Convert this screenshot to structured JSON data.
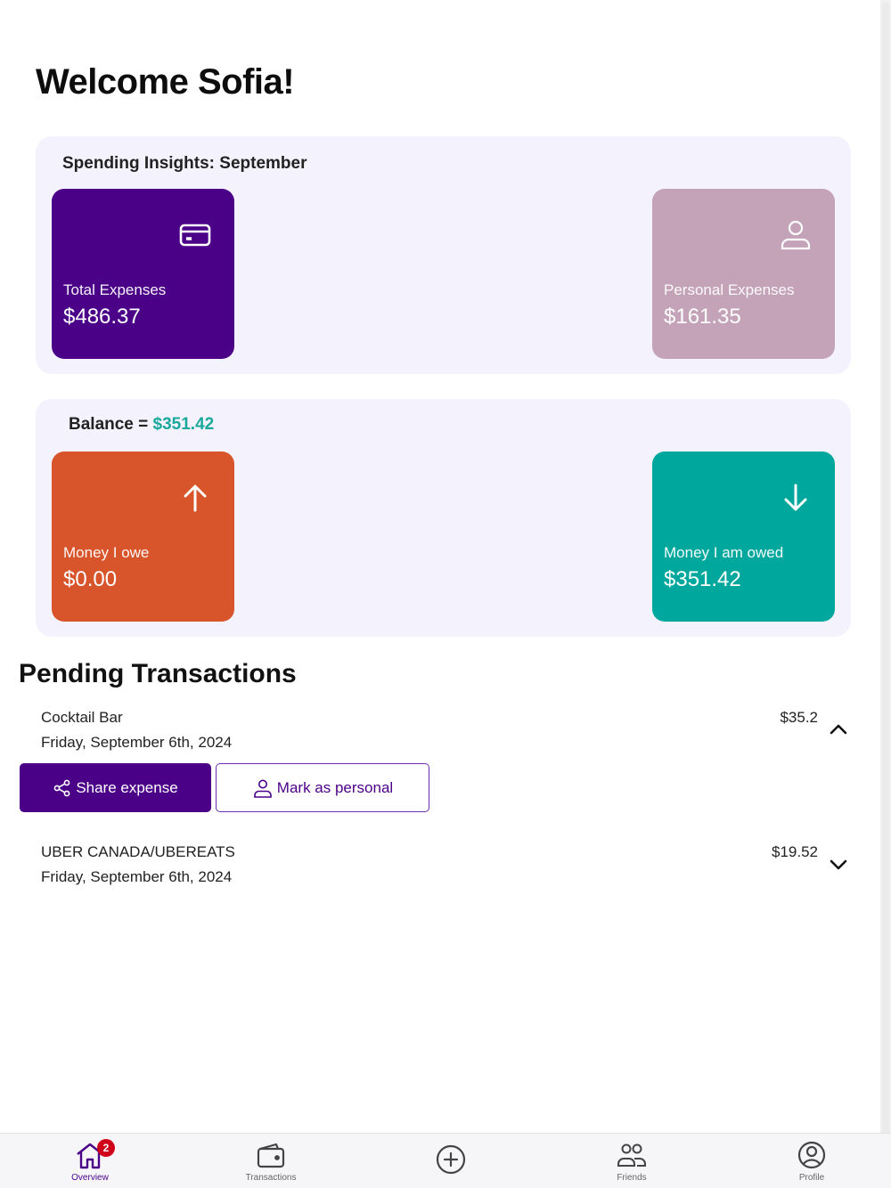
{
  "welcome": "Welcome Sofia!",
  "insights": {
    "title": "Spending Insights: September",
    "total": {
      "label": "Total Expenses",
      "value": "$486.37",
      "icon": "credit-card-icon"
    },
    "personal": {
      "label": "Personal Expenses",
      "value": "$161.35",
      "icon": "user-icon"
    }
  },
  "balance": {
    "label": "Balance = ",
    "amount": "$351.42",
    "owe": {
      "label": "Money I owe",
      "value": "$0.00",
      "icon": "arrow-up-icon"
    },
    "owed": {
      "label": "Money I am owed",
      "value": "$351.42",
      "icon": "arrow-down-icon"
    }
  },
  "pending": {
    "title": "Pending Transactions",
    "items": [
      {
        "name": "Cocktail Bar",
        "date": "Friday, September 6th, 2024",
        "amount": "$35.2",
        "expanded": true
      },
      {
        "name": "UBER CANADA/UBEREATS",
        "date": "Friday, September 6th, 2024",
        "amount": "$19.52",
        "expanded": false
      }
    ],
    "actions": {
      "share": "Share expense",
      "personal": "Mark as personal"
    }
  },
  "nav": {
    "items": [
      {
        "label": "Overview",
        "icon": "home-icon",
        "active": true,
        "badge": "2"
      },
      {
        "label": "Transactions",
        "icon": "wallet-icon",
        "active": false
      },
      {
        "label": "",
        "icon": "add-circle-icon",
        "active": false
      },
      {
        "label": "Friends",
        "icon": "friends-icon",
        "active": false
      },
      {
        "label": "Profile",
        "icon": "profile-icon",
        "active": false
      }
    ]
  },
  "colors": {
    "primary": "#4b0088",
    "personal": "#c4a3b8",
    "owe": "#d8542b",
    "owed": "#00a79d",
    "balance_text": "#1aa89c",
    "badge": "#d0021b"
  }
}
